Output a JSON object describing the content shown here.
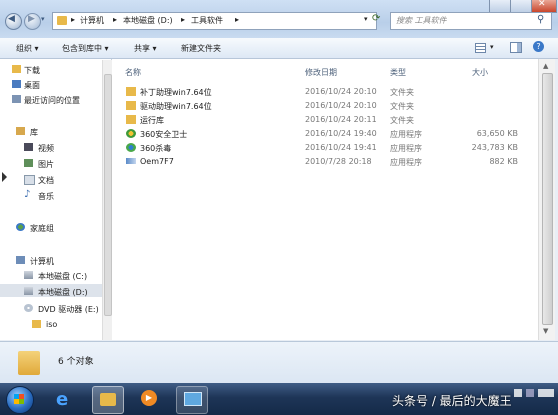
{
  "address": {
    "segments": [
      "计算机",
      "本地磁盘 (D:)",
      "工具软件"
    ],
    "search_placeholder": "搜索 工具软件"
  },
  "toolbar": {
    "organize": "组织 ▾",
    "include_in_library": "包含到库中 ▾",
    "share": "共享 ▾",
    "new_folder": "新建文件夹"
  },
  "nav": {
    "favorites": [
      "下载",
      "桌面",
      "最近访问的位置"
    ],
    "library_header": "库",
    "libraries": [
      "视频",
      "图片",
      "文档",
      "音乐"
    ],
    "homegroup": "家庭组",
    "computer_header": "计算机",
    "drives": [
      "本地磁盘 (C:)",
      "本地磁盘 (D:)",
      "DVD 驱动器 (E:)"
    ],
    "sub": "iso"
  },
  "columns": {
    "name": "名称",
    "date": "修改日期",
    "type": "类型",
    "size": "大小"
  },
  "files": [
    {
      "name": "补丁助理win7.64位",
      "date": "2016/10/24 20:10",
      "type": "文件夹",
      "size": ""
    },
    {
      "name": "驱动助理win7.64位",
      "date": "2016/10/24 20:10",
      "type": "文件夹",
      "size": ""
    },
    {
      "name": "运行库",
      "date": "2016/10/24 20:11",
      "type": "文件夹",
      "size": ""
    },
    {
      "name": "360安全卫士",
      "date": "2016/10/24 19:40",
      "type": "应用程序",
      "size": "63,650 KB"
    },
    {
      "name": "360杀毒",
      "date": "2016/10/24 19:41",
      "type": "应用程序",
      "size": "243,783 KB"
    },
    {
      "name": "Oem7F7",
      "date": "2010/7/28 20:18",
      "type": "应用程序",
      "size": "882 KB"
    }
  ],
  "details": {
    "count": "6 个对象"
  },
  "watermark": "头条号 / 最后的大魔王"
}
